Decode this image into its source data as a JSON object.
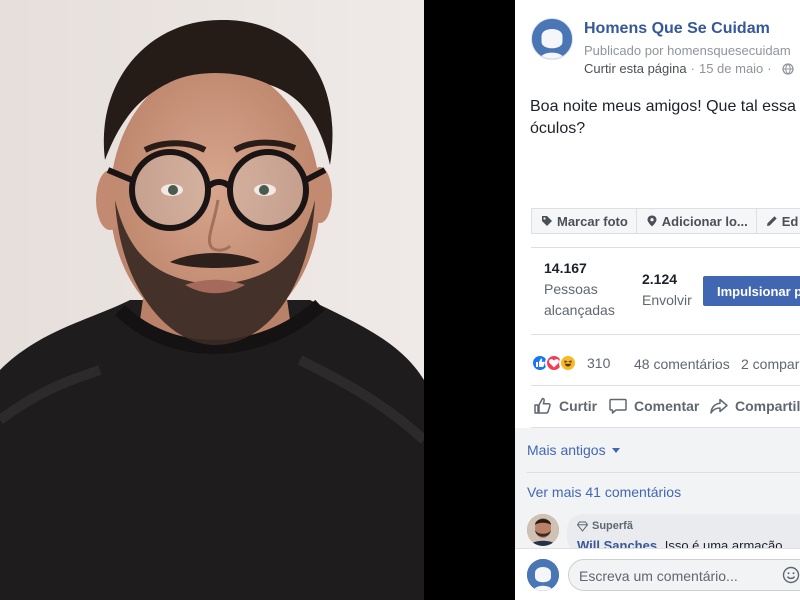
{
  "photo": {
    "description_icon": "portrait-photo"
  },
  "page": {
    "name": "Homens Que Se Cuidam",
    "published_by": "Publicado por homensquesecuidam",
    "like_page": "Curtir esta página",
    "separator": "·",
    "date": "15 de maio",
    "dot": "·",
    "visibility_icon": "globe-icon"
  },
  "post": {
    "text_line1": "Boa noite meus amigos! Que tal essa arm",
    "text_line2": "óculos?"
  },
  "tag_bar": {
    "tag_photo": "Marcar foto",
    "add_location": "Adicionar lo...",
    "edit": "Ed"
  },
  "stats": {
    "reached_value": "14.167",
    "reached_label_1": "Pessoas",
    "reached_label_2": "alcançadas",
    "engagement_value": "2.124",
    "engagement_label": "Envolvir",
    "boost_label": "Impulsionar p"
  },
  "reactions": {
    "count": "310",
    "comments": "48 comentários",
    "shares": "2 compar"
  },
  "actions": {
    "like": "Curtir",
    "comment": "Comentar",
    "share": "Compartil"
  },
  "comments": {
    "older_label": "Mais antigos",
    "view_more": "Ver mais 41 comentários",
    "first": {
      "badge": "Superfã",
      "author": "Will Sanches",
      "text": "Isso é uma armação"
    }
  },
  "composer": {
    "placeholder": "Escreva um comentário..."
  },
  "colors": {
    "link": "#365899",
    "accent": "#4267b2",
    "muted": "#90949c",
    "like": "#1877f2",
    "love": "#f33e58",
    "haha": "#f7b928"
  }
}
